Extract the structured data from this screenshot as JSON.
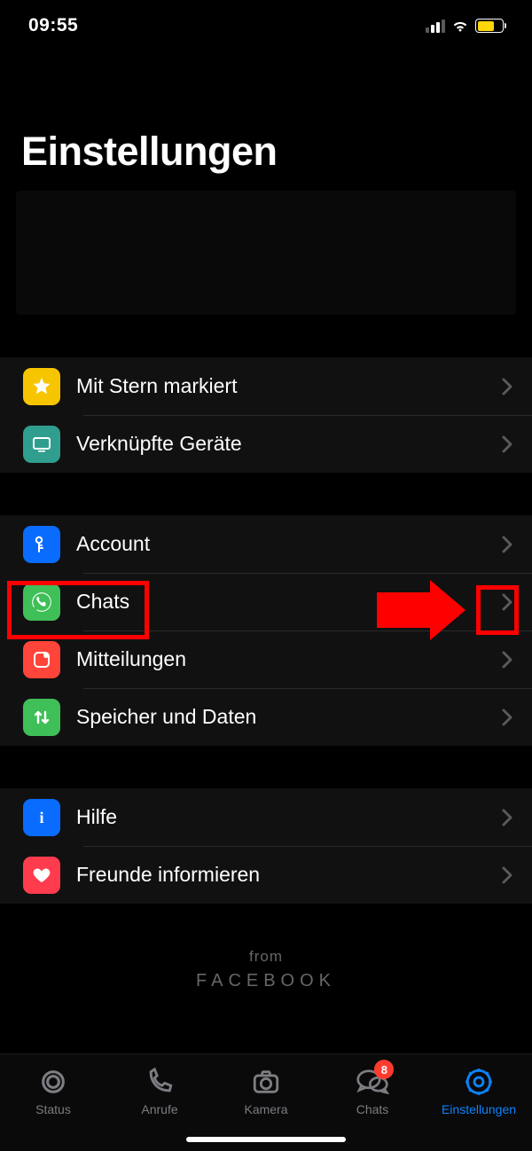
{
  "statusbar": {
    "time": "09:55"
  },
  "title": "Einstellungen",
  "group1": {
    "starred": "Mit Stern markiert",
    "linked": "Verknüpfte Geräte"
  },
  "group2": {
    "account": "Account",
    "chats": "Chats",
    "notifications": "Mitteilungen",
    "storage": "Speicher und Daten"
  },
  "group3": {
    "help": "Hilfe",
    "tell": "Freunde informieren"
  },
  "footer": {
    "from": "from",
    "brand": "FACEBOOK"
  },
  "tabs": {
    "status": "Status",
    "calls": "Anrufe",
    "camera": "Kamera",
    "chats": "Chats",
    "settings": "Einstellungen",
    "badge": "8"
  },
  "colors": {
    "starred": "#f7c500",
    "linked": "#2f9e8f",
    "account": "#0a6cff",
    "chats": "#3fbf57",
    "notifications": "#ff453a",
    "storage": "#3fbf57",
    "help": "#0a6cff",
    "tell": "#ff3b4e"
  }
}
